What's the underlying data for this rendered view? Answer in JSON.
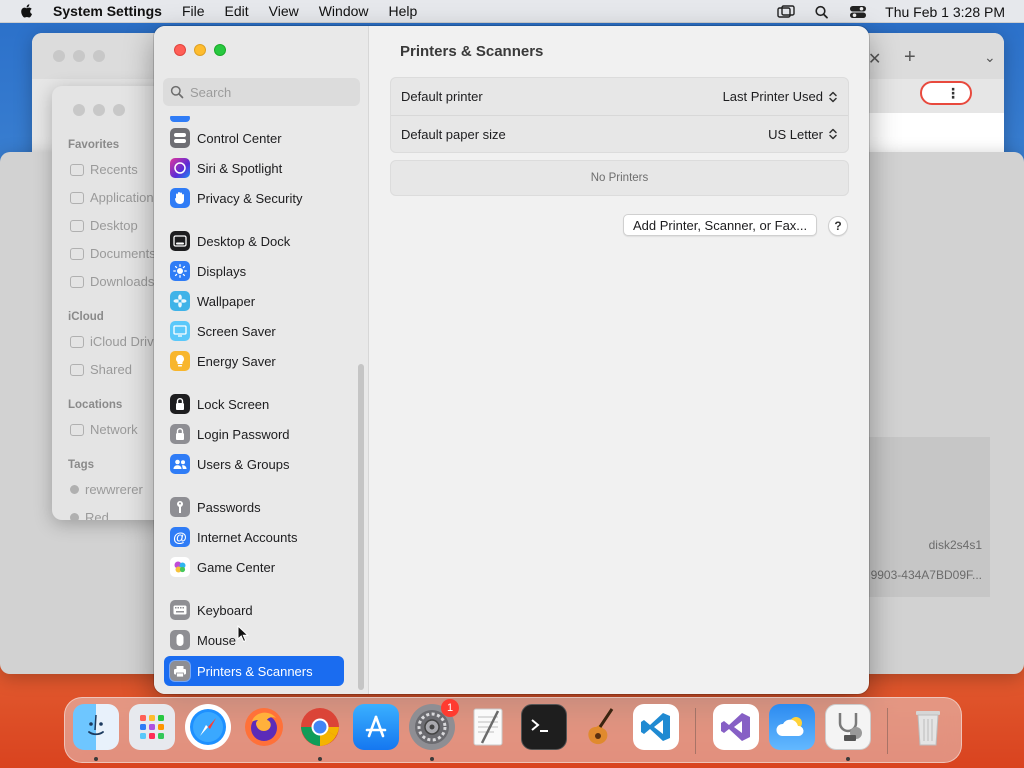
{
  "menubar": {
    "app_name": "System Settings",
    "items": [
      "File",
      "Edit",
      "View",
      "Window",
      "Help"
    ],
    "clock": "Thu Feb 1  3:28 PM"
  },
  "finder_bg": {
    "sections": [
      "Favorites",
      "iCloud",
      "Locations",
      "Tags"
    ],
    "favorites": [
      "Recents",
      "Applications",
      "Desktop",
      "Documents",
      "Downloads"
    ],
    "icloud": [
      "iCloud Drive",
      "Shared"
    ],
    "locations": [
      "Network"
    ],
    "tags": [
      "rewwrerer",
      "Red"
    ]
  },
  "disk_bg": {
    "device": "disk2s4s1",
    "uuid": "9903-434A7BD09F..."
  },
  "settings": {
    "search_placeholder": "Search",
    "sidebar": [
      {
        "label": "Control Center",
        "icon": "control-center-icon",
        "color": "#6e6e73"
      },
      {
        "label": "Siri & Spotlight",
        "icon": "siri-icon",
        "color": "#8e3ccf"
      },
      {
        "label": "Privacy & Security",
        "icon": "hand-icon",
        "color": "#2f7cf6"
      },
      {
        "label": "Desktop & Dock",
        "icon": "dock-icon",
        "color": "#1d1d1f"
      },
      {
        "label": "Displays",
        "icon": "sun-icon",
        "color": "#2f7cf6"
      },
      {
        "label": "Wallpaper",
        "icon": "flower-icon",
        "color": "#3fb3e8"
      },
      {
        "label": "Screen Saver",
        "icon": "screen-saver-icon",
        "color": "#5ac8fa"
      },
      {
        "label": "Energy Saver",
        "icon": "lightbulb-icon",
        "color": "#f8b62c"
      },
      {
        "label": "Lock Screen",
        "icon": "lock-icon",
        "color": "#1d1d1f"
      },
      {
        "label": "Login Password",
        "icon": "lock-icon",
        "color": "#8e8e93"
      },
      {
        "label": "Users & Groups",
        "icon": "users-icon",
        "color": "#2f7cf6"
      },
      {
        "label": "Passwords",
        "icon": "key-icon",
        "color": "#8e8e93"
      },
      {
        "label": "Internet Accounts",
        "icon": "at-icon",
        "color": "#2f7cf6"
      },
      {
        "label": "Game Center",
        "icon": "game-center-icon",
        "color": "#ffffff"
      },
      {
        "label": "Keyboard",
        "icon": "keyboard-icon",
        "color": "#8e8e93"
      },
      {
        "label": "Mouse",
        "icon": "mouse-icon",
        "color": "#8e8e93"
      },
      {
        "label": "Printers & Scanners",
        "icon": "printer-icon",
        "color": "#8e8e93"
      }
    ],
    "main": {
      "title": "Printers & Scanners",
      "default_printer_label": "Default printer",
      "default_printer_value": "Last Printer Used",
      "paper_size_label": "Default paper size",
      "paper_size_value": "US Letter",
      "no_printers": "No Printers",
      "add_button": "Add Printer, Scanner, or Fax...",
      "help": "?"
    }
  },
  "dock": {
    "apps": [
      "finder-icon",
      "launchpad-icon",
      "safari-icon",
      "firefox-icon",
      "chrome-icon",
      "app-store-icon",
      "system-settings-icon",
      "textedit-icon",
      "terminal-icon",
      "garageband-icon",
      "vscode-icon",
      "visual-studio-icon",
      "weather-icon",
      "disk-utility-icon",
      "trash-icon"
    ],
    "settings_badge": "1"
  }
}
